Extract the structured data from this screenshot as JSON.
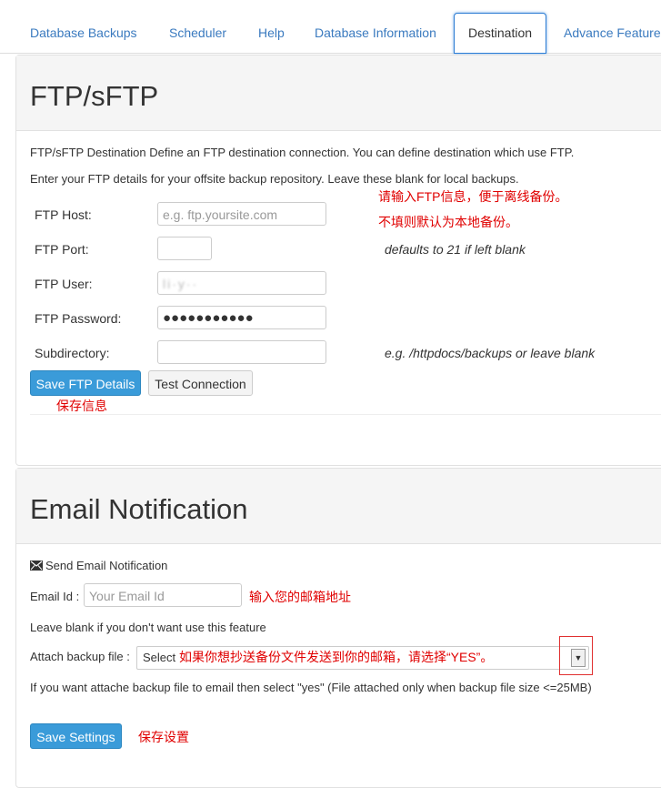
{
  "tabs": [
    {
      "label": "Database Backups"
    },
    {
      "label": "Scheduler"
    },
    {
      "label": "Help"
    },
    {
      "label": "Database Information"
    },
    {
      "label": "Destination"
    },
    {
      "label": "Advance Feature"
    }
  ],
  "ftp": {
    "title": "FTP/sFTP",
    "description": "FTP/sFTP Destination Define an FTP destination connection. You can define destination which use FTP.",
    "instructions": "Enter your FTP details for your offsite backup repository. Leave these blank for local backups.",
    "host_label": "FTP Host:",
    "host_placeholder": "e.g. ftp.yoursite.com",
    "port_label": "FTP Port:",
    "port_value": "",
    "port_hint": "defaults to 21 if left blank",
    "user_label": "FTP User:",
    "user_value": "li·y··",
    "password_label": "FTP Password:",
    "password_value": "●●●●●●●●●●●",
    "subdir_label": "Subdirectory:",
    "subdir_value": "",
    "subdir_hint": "e.g. /httpdocs/backups or leave blank",
    "save_button": "Save FTP Details",
    "test_button": "Test Connection",
    "annotation_enter": "请输入FTP信息，便于离线备份。",
    "annotation_local": "不填则默认为本地备份。",
    "annotation_save": "保存信息"
  },
  "email": {
    "title": "Email Notification",
    "send_label": "Send Email Notification",
    "envelope_icon": "envelope-icon",
    "email_label": "Email Id :",
    "email_placeholder": "Your Email Id",
    "annotation_email": "输入您的邮箱地址",
    "blank_note": "Leave blank if you don't want use this feature",
    "attach_label": "Attach backup file :",
    "attach_selected": "Select",
    "annotation_attach": "如果你想抄送备份文件发送到你的邮箱，请选择“YES”。",
    "attach_note": "If you want attache backup file to email then select \"yes\" (File attached only when backup file size <=25MB)",
    "save_button": "Save Settings",
    "annotation_save": "保存设置"
  },
  "colors": {
    "link": "#3a7abf",
    "primary": "#3a9bd9",
    "annotation": "#e00000"
  }
}
